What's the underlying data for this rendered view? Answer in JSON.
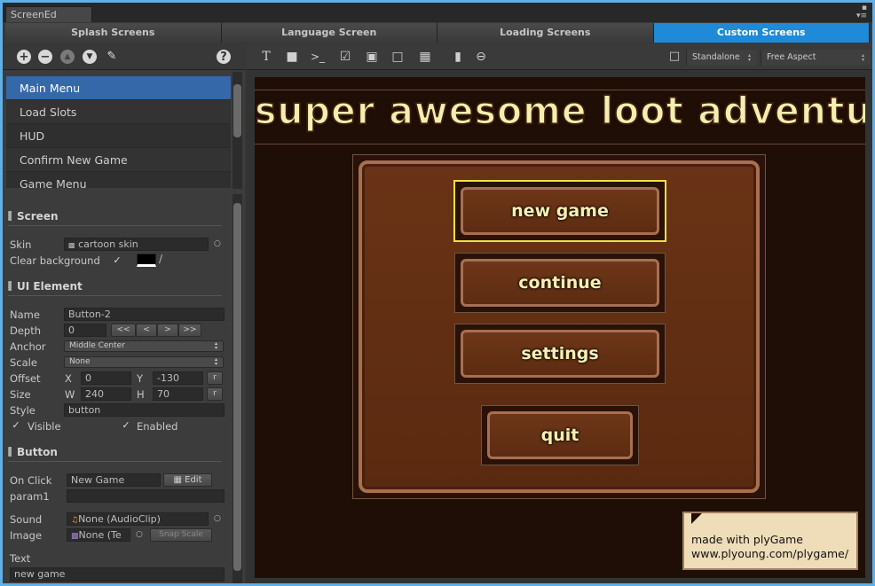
{
  "window": {
    "tab_title": "ScreenEd"
  },
  "tabs": [
    {
      "label": "Splash Screens"
    },
    {
      "label": "Language Screen"
    },
    {
      "label": "Loading Screens"
    },
    {
      "label": "Custom Screens",
      "active": true
    }
  ],
  "screens_list": [
    "Main Menu",
    "Load Slots",
    "HUD",
    "Confirm New Game",
    "Game Menu"
  ],
  "selected_screen": "Main Menu",
  "screen_section": {
    "title": "Screen",
    "skin_label": "Skin",
    "skin_value": "cartoon skin",
    "clear_bg_label": "Clear background",
    "clear_bg_checked": true,
    "clear_bg_color": "#000000"
  },
  "ui_element": {
    "title": "UI Element",
    "name_label": "Name",
    "name_value": "Button-2",
    "depth_label": "Depth",
    "depth_value": "0",
    "depth_buttons": [
      "<<",
      "<",
      ">",
      ">>"
    ],
    "anchor_label": "Anchor",
    "anchor_value": "Middle Center",
    "scale_label": "Scale",
    "scale_value": "None",
    "offset_label": "Offset",
    "offset_x_label": "X",
    "offset_x": "0",
    "offset_y_label": "Y",
    "offset_y": "-130",
    "size_label": "Size",
    "size_w_label": "W",
    "size_w": "240",
    "size_h_label": "H",
    "size_h": "70",
    "reset_label": "r",
    "style_label": "Style",
    "style_value": "button",
    "visible_label": "Visible",
    "enabled_label": "Enabled"
  },
  "button_section": {
    "title": "Button",
    "onclick_label": "On Click",
    "onclick_value": "New Game",
    "edit_label": "Edit",
    "param1_label": "param1",
    "param1_value": "",
    "sound_label": "Sound",
    "sound_value": "None (AudioClip)",
    "image_label": "Image",
    "image_value": "None (Te",
    "snap_scale_label": "Snap Scale",
    "text_label": "Text",
    "text_value": "new game"
  },
  "preview": {
    "platform": "Standalone",
    "aspect": "Free Aspect",
    "title": "super awesome loot adventure",
    "buttons": [
      "new game",
      "continue",
      "settings",
      "quit"
    ],
    "promo_line1": "made with plyGame",
    "promo_line2": "www.plyoung.com/plygame/"
  },
  "colors": {
    "accent": "#1e8ad8",
    "selection": "#3568a8",
    "highlight": "#f0e040"
  }
}
